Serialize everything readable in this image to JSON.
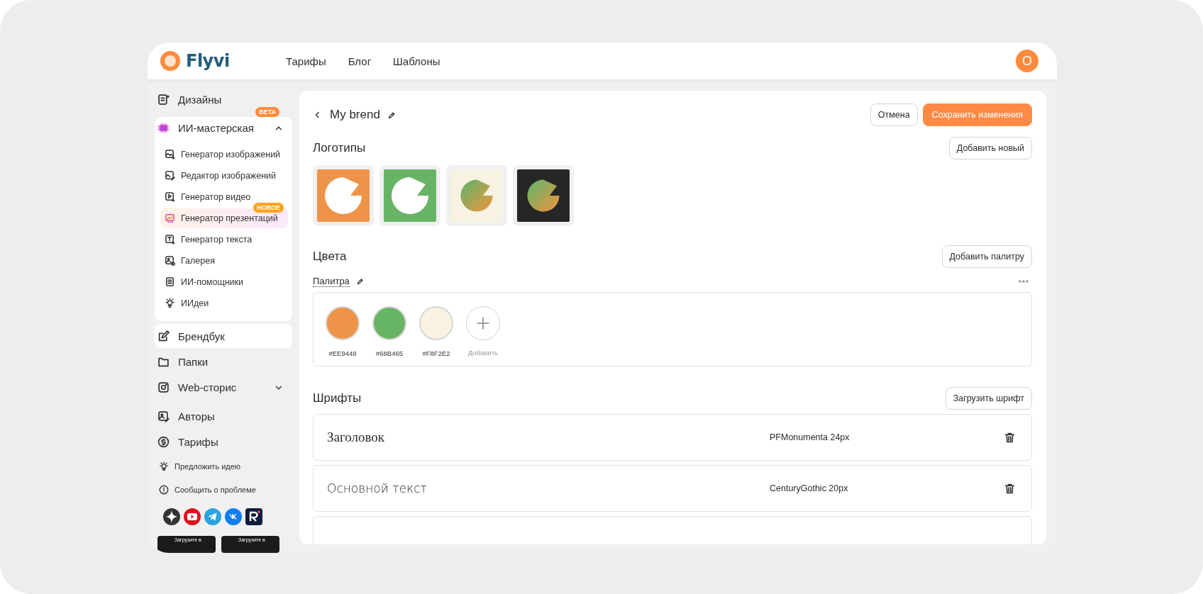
{
  "header": {
    "logo": "Flyvi",
    "nav": [
      {
        "label": "Тарифы"
      },
      {
        "label": "Блог"
      },
      {
        "label": "Шаблоны"
      }
    ],
    "avatar": "O"
  },
  "sidebar": {
    "items": [
      {
        "kind": "link",
        "label": "Дизайны",
        "selected": false
      },
      {
        "kind": "group",
        "label": "ИИ-мастерская",
        "badge": "BETA",
        "selected": false,
        "expanded": true,
        "children": [
          {
            "label": "Генератор изображений",
            "selected": false
          },
          {
            "label": "Редактор изображений",
            "selected": false
          },
          {
            "label": "Генератор видео",
            "selected": false
          },
          {
            "label": "Генератор презентаций",
            "badge": "НОВОЕ",
            "selected": true
          },
          {
            "label": "Генератор текста",
            "selected": false
          },
          {
            "label": "Галерея",
            "selected": false
          },
          {
            "label": "ИИ-помощники",
            "selected": false
          },
          {
            "label": "ИИдеи",
            "selected": false
          }
        ]
      },
      {
        "kind": "link",
        "label": "Брендбук",
        "selected": true
      },
      {
        "kind": "link",
        "label": "Папки",
        "selected": false
      },
      {
        "kind": "group",
        "label": "Web-сторис",
        "selected": false,
        "expanded": false
      },
      {
        "kind": "link",
        "label": "Авторы",
        "selected": false
      },
      {
        "kind": "link",
        "label": "Тарифы",
        "selected": false
      }
    ],
    "footer_links": [
      "Предложить идею",
      "Сообщить о проблеме"
    ],
    "app_badges": [
      "Загрузите в",
      "Загрузите в"
    ]
  },
  "brand": {
    "title": "My brend",
    "buttons": [
      {
        "label": "Отмена",
        "kind": "secondary"
      },
      {
        "label": "Сохранить изменения",
        "kind": "primary"
      }
    ]
  },
  "logos": {
    "heading": "Логотипы",
    "button": "Добавить новый",
    "items": [
      {
        "color": "#ee9448",
        "kind": "white"
      },
      {
        "color": "#68b465",
        "kind": "white"
      },
      {
        "color": "#f8f2e2",
        "kind": "gradient"
      },
      {
        "color": "#262626",
        "kind": "gradient"
      }
    ]
  },
  "colors": {
    "heading": "Цвета",
    "button": "Добавить палитру",
    "palette_name": "Палитра",
    "swatches": [
      {
        "color": "#ee9448",
        "label": "#EE9448"
      },
      {
        "color": "#68b465",
        "label": "#68B465"
      },
      {
        "color": "#f8f2e2",
        "label": "#F8F2E2"
      }
    ],
    "add_label": "Добавить"
  },
  "fonts": {
    "heading": "Шрифты",
    "button": "Загрузить шрифт",
    "rows": [
      {
        "sample": "Заголовок",
        "font": "PFMonumenta 24px",
        "kind": "serif"
      },
      {
        "sample": "Основной текст",
        "font": "CenturyGothic 20px",
        "kind": "sans"
      }
    ]
  }
}
